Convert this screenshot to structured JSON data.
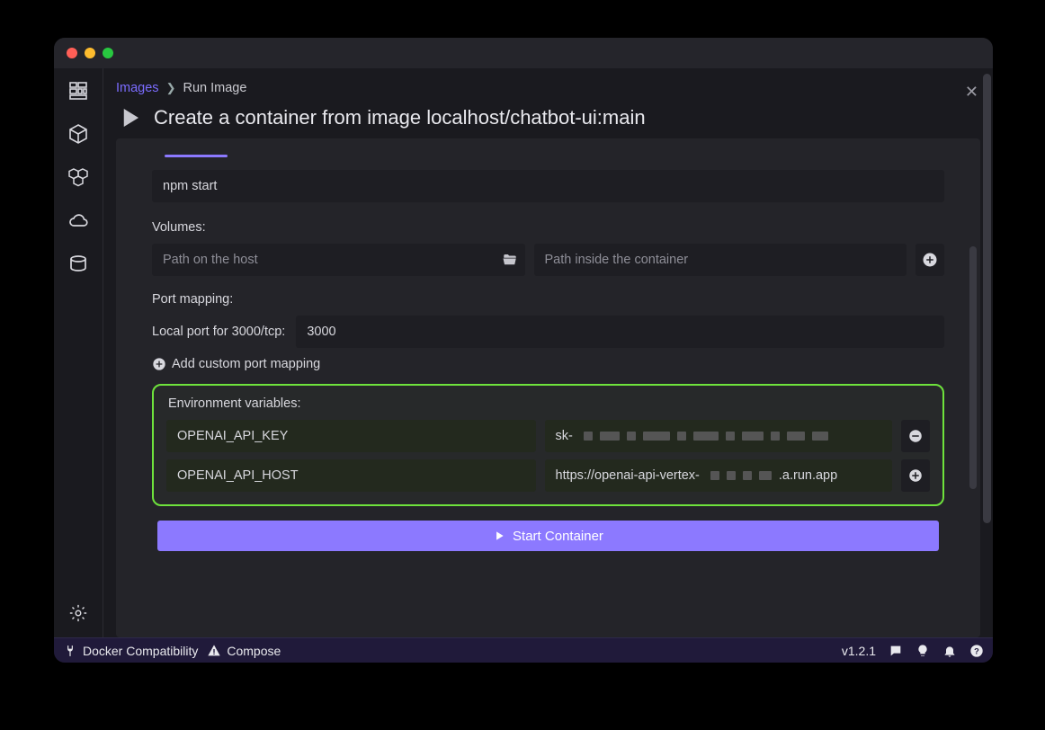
{
  "breadcrumb": {
    "root": "Images",
    "current": "Run Image"
  },
  "header": {
    "title": "Create a container from image localhost/chatbot-ui:main"
  },
  "form": {
    "command_value": "npm start",
    "volumes_label": "Volumes:",
    "volume_host_placeholder": "Path on the host",
    "volume_container_placeholder": "Path inside the container",
    "port_mapping_label": "Port mapping:",
    "port_label": "Local port for 3000/tcp:",
    "port_value": "3000",
    "add_port_label": "Add custom port mapping",
    "env_label": "Environment variables:",
    "env": [
      {
        "name": "OPENAI_API_KEY",
        "value_prefix": "sk-",
        "value_suffix": ""
      },
      {
        "name": "OPENAI_API_HOST",
        "value_prefix": "https://openai-api-vertex-",
        "value_suffix": ".a.run.app"
      }
    ],
    "start_label": "Start Container"
  },
  "status": {
    "docker_compat": "Docker Compatibility",
    "compose": "Compose",
    "version": "v1.2.1"
  }
}
